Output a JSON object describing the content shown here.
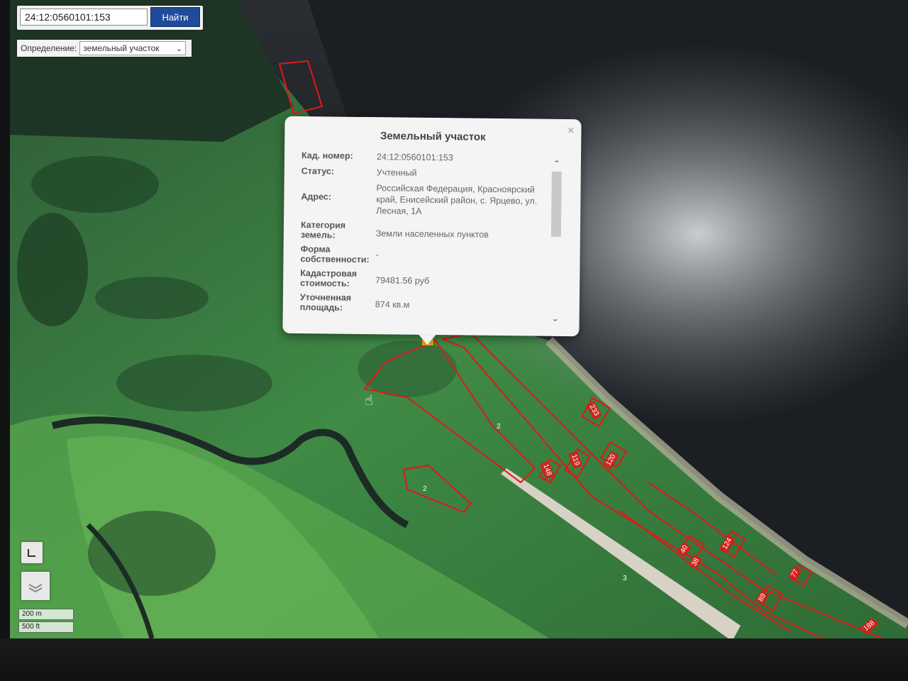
{
  "search": {
    "value": "24:12:0560101:153",
    "button_label": "Найти"
  },
  "definition": {
    "label": "Определение:",
    "selected": "земельный участок"
  },
  "popup": {
    "title": "Земельный участок",
    "close_symbol": "×",
    "rows": [
      {
        "key": "Кад. номер:",
        "value": "24:12:0560101:153"
      },
      {
        "key": "Статус:",
        "value": "Учтенный"
      },
      {
        "key": "Адрес:",
        "value": "Российская Федерация, Красноярский край, Енисейский район, с. Ярцево, ул. Лесная, 1А"
      },
      {
        "key": "Категория земель:",
        "value": "Земли населенных пунктов"
      },
      {
        "key": "Форма собственности:",
        "value": "-"
      },
      {
        "key": "Кадастровая стоимость:",
        "value": "79481.56 руб"
      },
      {
        "key": "Уточненная площадь:",
        "value": "874 кв.м"
      }
    ]
  },
  "parcel_labels": [
    "233",
    "119",
    "120",
    "148",
    "2",
    "2",
    "3",
    "40",
    "38",
    "124",
    "77",
    "89",
    "188"
  ],
  "scale": {
    "metric": "200 m",
    "imperial": "500 ft"
  },
  "icons": {
    "close": "close-icon",
    "chevron": "chevron-down-icon",
    "scroll_up": "chevron-up-icon",
    "scroll_down": "chevron-down-icon",
    "tool1": "fullscreen-icon",
    "tool2": "layers-icon",
    "cursor": "hand-cursor-icon"
  },
  "colors": {
    "parcel_outline": "#e01818",
    "button_bg": "#1f4b9a"
  }
}
